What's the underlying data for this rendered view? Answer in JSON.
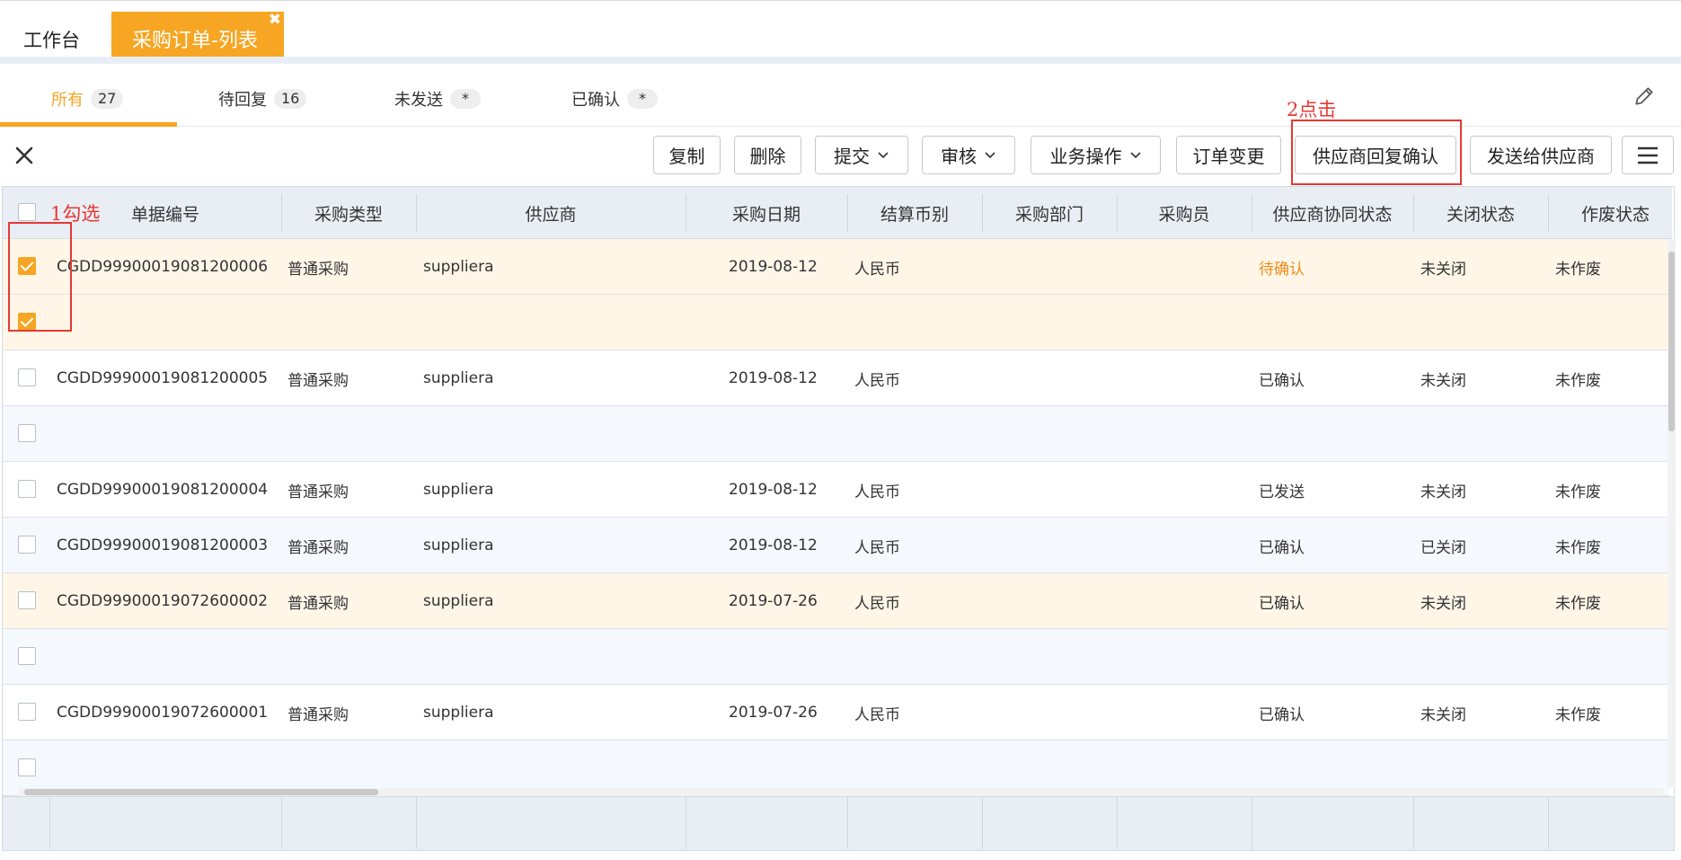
{
  "tabs": {
    "home": "工作台",
    "active": "采购订单-列表",
    "close_glyph": "✖"
  },
  "filters": [
    {
      "label": "所有",
      "count": "27"
    },
    {
      "label": "待回复",
      "count": "16"
    },
    {
      "label": "未发送",
      "count": "*"
    },
    {
      "label": "已确认",
      "count": "*"
    }
  ],
  "toolbar": {
    "copy": "复制",
    "delete": "删除",
    "submit": "提交",
    "audit": "审核",
    "business_ops": "业务操作",
    "order_change": "订单变更",
    "supplier_reply_confirm": "供应商回复确认",
    "send_to_supplier": "发送给供应商"
  },
  "columns": [
    "单据编号",
    "采购类型",
    "供应商",
    "采购日期",
    "结算币别",
    "采购部门",
    "采购员",
    "供应商协同状态",
    "关闭状态",
    "作废状态"
  ],
  "rows": [
    {
      "checked": true,
      "code": "CGDD99900019081200006",
      "type": "普通采购",
      "supplier": "suppliera",
      "date": "2019-08-12",
      "currency": "人民币",
      "dept": "",
      "buyer": "",
      "coop": "待确认",
      "close": "未关闭",
      "void": "未作废"
    },
    {
      "checked": true,
      "code": "",
      "type": "",
      "supplier": "",
      "date": "",
      "currency": "",
      "dept": "",
      "buyer": "",
      "coop": "",
      "close": "",
      "void": ""
    },
    {
      "checked": false,
      "code": "CGDD99900019081200005",
      "type": "普通采购",
      "supplier": "suppliera",
      "date": "2019-08-12",
      "currency": "人民币",
      "dept": "",
      "buyer": "",
      "coop": "已确认",
      "close": "未关闭",
      "void": "未作废"
    },
    {
      "checked": false,
      "code": "",
      "type": "",
      "supplier": "",
      "date": "",
      "currency": "",
      "dept": "",
      "buyer": "",
      "coop": "",
      "close": "",
      "void": ""
    },
    {
      "checked": false,
      "code": "CGDD99900019081200004",
      "type": "普通采购",
      "supplier": "suppliera",
      "date": "2019-08-12",
      "currency": "人民币",
      "dept": "",
      "buyer": "",
      "coop": "已发送",
      "close": "未关闭",
      "void": "未作废"
    },
    {
      "checked": false,
      "code": "CGDD99900019081200003",
      "type": "普通采购",
      "supplier": "suppliera",
      "date": "2019-08-12",
      "currency": "人民币",
      "dept": "",
      "buyer": "",
      "coop": "已确认",
      "close": "已关闭",
      "void": "未作废"
    },
    {
      "checked": false,
      "code": "CGDD99900019072600002",
      "type": "普通采购",
      "supplier": "suppliera",
      "date": "2019-07-26",
      "currency": "人民币",
      "dept": "",
      "buyer": "",
      "coop": "已确认",
      "close": "未关闭",
      "void": "未作废"
    },
    {
      "checked": false,
      "code": "",
      "type": "",
      "supplier": "",
      "date": "",
      "currency": "",
      "dept": "",
      "buyer": "",
      "coop": "",
      "close": "",
      "void": ""
    },
    {
      "checked": false,
      "code": "CGDD99900019072600001",
      "type": "普通采购",
      "supplier": "suppliera",
      "date": "2019-07-26",
      "currency": "人民币",
      "dept": "",
      "buyer": "",
      "coop": "已确认",
      "close": "未关闭",
      "void": "未作废"
    },
    {
      "checked": false,
      "code": "",
      "type": "",
      "supplier": "",
      "date": "",
      "currency": "",
      "dept": "",
      "buyer": "",
      "coop": "",
      "close": "",
      "void": ""
    }
  ],
  "annotations": {
    "step1": "1勾选",
    "step2": "2点击"
  },
  "colors": {
    "accent": "#f6a623",
    "pending": "#f08c1a",
    "annotation": "#e53935"
  }
}
